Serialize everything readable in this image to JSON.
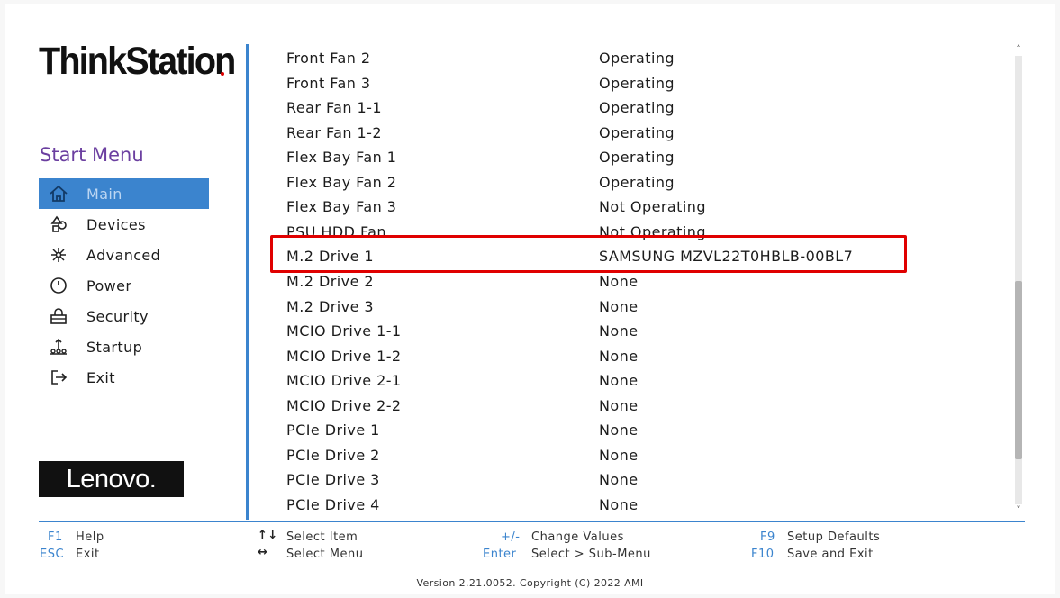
{
  "brand": {
    "logo_text": "ThinkStation",
    "vendor_logo_text": "Lenovo."
  },
  "sidebar": {
    "title": "Start Menu",
    "items": [
      {
        "label": "Main",
        "icon": "home-icon",
        "active": true
      },
      {
        "label": "Devices",
        "icon": "devices-icon",
        "active": false
      },
      {
        "label": "Advanced",
        "icon": "advanced-icon",
        "active": false
      },
      {
        "label": "Power",
        "icon": "power-icon",
        "active": false
      },
      {
        "label": "Security",
        "icon": "security-icon",
        "active": false
      },
      {
        "label": "Startup",
        "icon": "startup-icon",
        "active": false
      },
      {
        "label": "Exit",
        "icon": "exit-icon",
        "active": false
      }
    ]
  },
  "main": {
    "rows": [
      {
        "key": "Front Fan 2",
        "value": "Operating"
      },
      {
        "key": "Front Fan 3",
        "value": "Operating"
      },
      {
        "key": "Rear Fan 1-1",
        "value": "Operating"
      },
      {
        "key": "Rear Fan 1-2",
        "value": "Operating"
      },
      {
        "key": "Flex Bay Fan 1",
        "value": "Operating"
      },
      {
        "key": "Flex Bay Fan 2",
        "value": "Operating"
      },
      {
        "key": "Flex Bay Fan 3",
        "value": "Not Operating"
      },
      {
        "key": "PSU HDD Fan",
        "value": "Not Operating"
      },
      {
        "key": "M.2 Drive 1",
        "value": "SAMSUNG MZVL22T0HBLB-00BL7"
      },
      {
        "key": "M.2 Drive 2",
        "value": "None"
      },
      {
        "key": "M.2 Drive 3",
        "value": "None"
      },
      {
        "key": "MCIO Drive 1-1",
        "value": "None"
      },
      {
        "key": "MCIO Drive 1-2",
        "value": "None"
      },
      {
        "key": "MCIO Drive 2-1",
        "value": "None"
      },
      {
        "key": "MCIO Drive 2-2",
        "value": "None"
      },
      {
        "key": "PCIe Drive 1",
        "value": "None"
      },
      {
        "key": "PCIe Drive 2",
        "value": "None"
      },
      {
        "key": "PCIe Drive 3",
        "value": "None"
      },
      {
        "key": "PCIe Drive 4",
        "value": "None"
      }
    ]
  },
  "footer": {
    "help_key": "F1",
    "help_label": "Help",
    "esc_key": "ESC",
    "esc_label": "Exit",
    "select_item_key": "↑↓",
    "select_item_label": "Select Item",
    "select_menu_key": "↔",
    "select_menu_label": "Select Menu",
    "change_key": "+/-",
    "change_label": "Change Values",
    "enter_key": "Enter",
    "enter_label": "Select > Sub-Menu",
    "f9_key": "F9",
    "f9_label": "Setup Defaults",
    "f10_key": "F10",
    "f10_label": "Save and Exit",
    "version": "Version 2.21.0052. Copyright (C) 2022 AMI"
  },
  "colors": {
    "accent": "#3b84ce",
    "menu_title": "#6b3fa0",
    "highlight_box": "#e00000"
  }
}
